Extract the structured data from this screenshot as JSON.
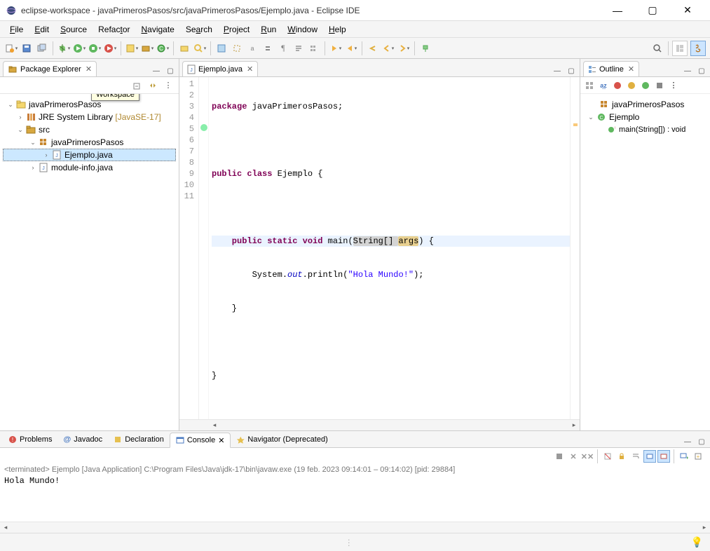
{
  "window": {
    "title": "eclipse-workspace - javaPrimerosPasos/src/javaPrimerosPasos/Ejemplo.java - Eclipse IDE"
  },
  "menu": {
    "file": "File",
    "edit": "Edit",
    "source": "Source",
    "refactor": "Refactor",
    "navigate": "Navigate",
    "search": "Search",
    "project": "Project",
    "run": "Run",
    "window": "Window",
    "help": "Help"
  },
  "package_explorer": {
    "title": "Package Explorer",
    "tooltip": "Workspace",
    "project": "javaPrimerosPasos",
    "jre": "JRE System Library",
    "jre_ver": "[JavaSE-17]",
    "src": "src",
    "pkg": "javaPrimerosPasos",
    "file1": "Ejemplo.java",
    "file2": "module-info.java"
  },
  "editor": {
    "tab": "Ejemplo.java",
    "lines": {
      "l1_a": "package",
      "l1_b": " javaPrimerosPasos;",
      "l3_a": "public",
      "l3_b": " class",
      "l3_c": " Ejemplo {",
      "l5_a": "    public",
      "l5_b": " static",
      "l5_c": " void",
      "l5_d": " main(",
      "l5_e": "String[] ",
      "l5_f": "args",
      "l5_g": ") {",
      "l6_a": "        System.",
      "l6_b": "out",
      "l6_c": ".println(",
      "l6_d": "\"Hola Mundo!\"",
      "l6_e": ");",
      "l7": "    }",
      "l9": "}"
    },
    "line_numbers": [
      "1",
      "2",
      "3",
      "4",
      "5",
      "6",
      "7",
      "8",
      "9",
      "10",
      "11"
    ]
  },
  "outline": {
    "title": "Outline",
    "pkg": "javaPrimerosPasos",
    "cls": "Ejemplo",
    "method": "main(String[]) : void"
  },
  "bottom_tabs": {
    "problems": "Problems",
    "javadoc": "Javadoc",
    "declaration": "Declaration",
    "console": "Console",
    "navigator": "Navigator (Deprecated)"
  },
  "console": {
    "status": "<terminated> Ejemplo [Java Application] C:\\Program Files\\Java\\jdk-17\\bin\\javaw.exe (19 feb. 2023 09:14:01 – 09:14:02) [pid: 29884]",
    "output": "Hola Mundo!"
  }
}
